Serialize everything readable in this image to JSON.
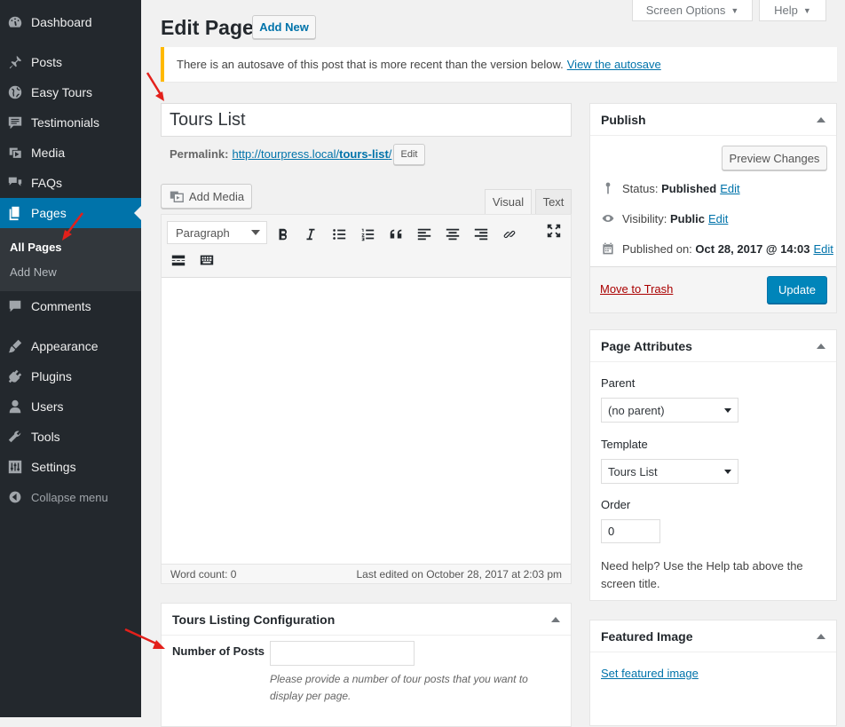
{
  "menu": {
    "items": [
      {
        "label": "Dashboard",
        "icon": "dashboard-icon"
      },
      {
        "label": "Posts",
        "icon": "pin-icon"
      },
      {
        "label": "Easy Tours",
        "icon": "globe-icon"
      },
      {
        "label": "Testimonials",
        "icon": "comment-lines-icon"
      },
      {
        "label": "Media",
        "icon": "media-icon"
      },
      {
        "label": "FAQs",
        "icon": "faq-icon"
      },
      {
        "label": "Pages",
        "icon": "pages-icon"
      },
      {
        "label": "Comments",
        "icon": "comment-icon"
      },
      {
        "label": "Appearance",
        "icon": "brush-icon"
      },
      {
        "label": "Plugins",
        "icon": "plugin-icon"
      },
      {
        "label": "Users",
        "icon": "user-icon"
      },
      {
        "label": "Tools",
        "icon": "wrench-icon"
      },
      {
        "label": "Settings",
        "icon": "settings-icon"
      }
    ],
    "submenu": [
      "All Pages",
      "Add New"
    ],
    "collapse": "Collapse menu"
  },
  "header": {
    "title": "Edit Page",
    "add_new": "Add New",
    "screen_options": "Screen Options",
    "help": "Help"
  },
  "notice": {
    "text": "There is an autosave of this post that is more recent than the version below.",
    "link": "View the autosave"
  },
  "post": {
    "title": "Tours List",
    "permalink_label": "Permalink:",
    "permalink_base": "http://tourpress.local/",
    "permalink_slug": "tours-list",
    "permalink_end": "/",
    "permalink_edit": "Edit"
  },
  "editor": {
    "add_media": "Add Media",
    "tab_visual": "Visual",
    "tab_text": "Text",
    "format": "Paragraph",
    "word_count": "Word count: 0",
    "last_edited": "Last edited on October 28, 2017 at 2:03 pm"
  },
  "tours_config": {
    "title": "Tours Listing Configuration",
    "field_label": "Number of Posts",
    "field_value": "",
    "help": "Please provide a number of tour posts that you want to display per page."
  },
  "publish": {
    "title": "Publish",
    "preview": "Preview Changes",
    "status_label": "Status:",
    "status_value": "Published",
    "visibility_label": "Visibility:",
    "visibility_value": "Public",
    "published_label": "Published on:",
    "published_value": "Oct 28, 2017 @ 14:03",
    "edit": "Edit",
    "trash": "Move to Trash",
    "update": "Update"
  },
  "page_attributes": {
    "title": "Page Attributes",
    "parent_label": "Parent",
    "parent_value": "(no parent)",
    "template_label": "Template",
    "template_value": "Tours List",
    "order_label": "Order",
    "order_value": "0",
    "help": "Need help? Use the Help tab above the screen title."
  },
  "featured": {
    "title": "Featured Image",
    "link": "Set featured image"
  },
  "colors": {
    "accent": "#0073aa",
    "sidebar": "#23282d",
    "notice": "#ffb900",
    "annotation": "#e3201b"
  }
}
